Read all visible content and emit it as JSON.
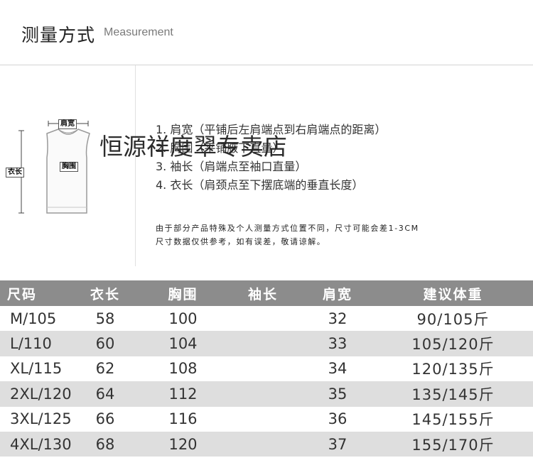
{
  "header": {
    "title_cn": "测量方式",
    "title_en": "Measurement"
  },
  "figure": {
    "tag_shoulder": "肩宽",
    "tag_length": "衣长",
    "tag_chest": "胸围"
  },
  "instructions": [
    "1. 肩宽（平铺后左肩端点到右肩端点的距离）",
    "2. 胸围（平铺腋下直量）",
    "3. 袖长（肩端点至袖口直量）",
    "4. 衣长（肩颈点至下摆底端的垂直长度）"
  ],
  "note": [
    "由于部分产品特殊及个人测量方式位置不同，尺寸可能会差1-3CM",
    "尺寸数据仅供参考，如有误差，敬请谅解。"
  ],
  "watermark": "恒源祥度翠专卖店",
  "table": {
    "headers": [
      "尺码",
      "衣长",
      "胸围",
      "袖长",
      "肩宽",
      "建议体重"
    ],
    "rows": [
      [
        "M/105",
        "58",
        "100",
        "",
        "32",
        "90/105斤"
      ],
      [
        "L/110",
        "60",
        "104",
        "",
        "33",
        "105/120斤"
      ],
      [
        "XL/115",
        "62",
        "108",
        "",
        "34",
        "120/135斤"
      ],
      [
        "2XL/120",
        "64",
        "112",
        "",
        "35",
        "135/145斤"
      ],
      [
        "3XL/125",
        "66",
        "116",
        "",
        "36",
        "145/155斤"
      ],
      [
        "4XL/130",
        "68",
        "120",
        "",
        "37",
        "155/170斤"
      ]
    ]
  }
}
